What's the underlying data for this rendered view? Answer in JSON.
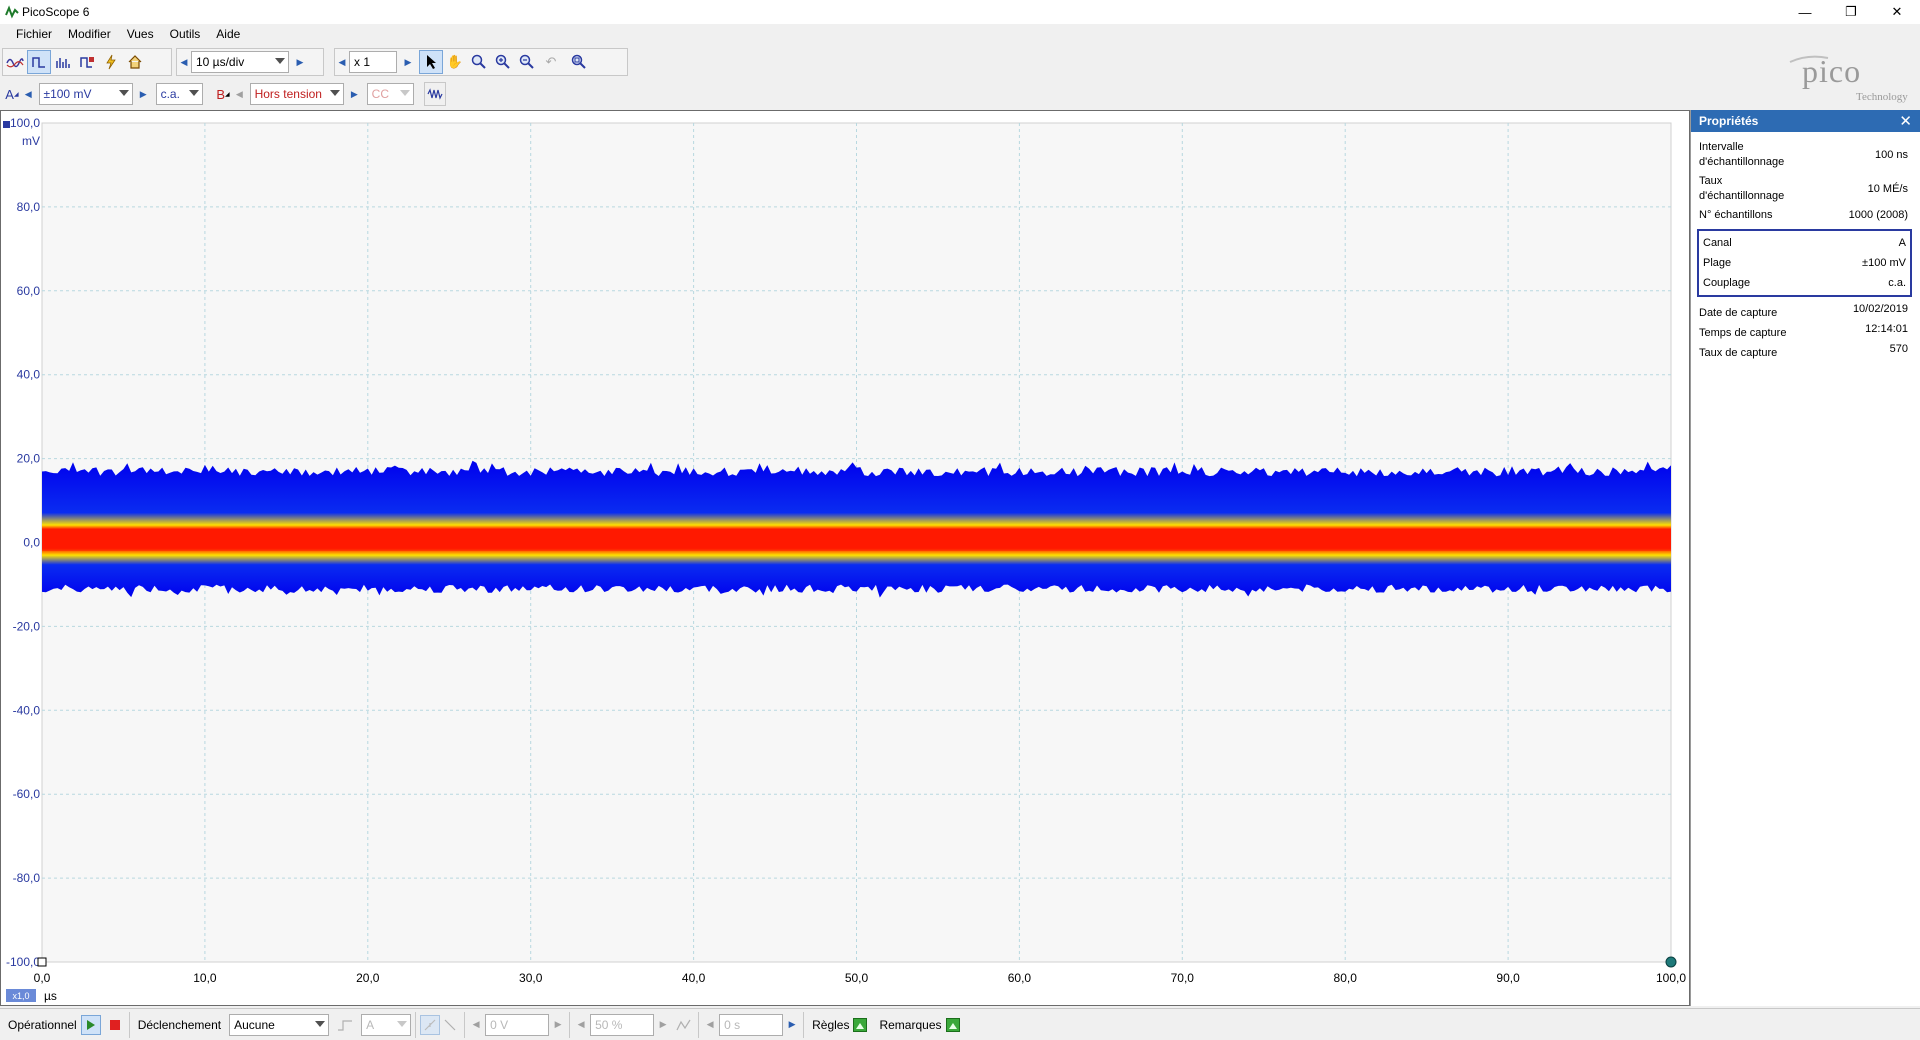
{
  "window": {
    "title": "PicoScope 6",
    "minimize": "—",
    "maximize": "❐",
    "close": "✕"
  },
  "menu": [
    "Fichier",
    "Modifier",
    "Vues",
    "Outils",
    "Aide"
  ],
  "toolbar1": {
    "timebase": "10 µs/div",
    "zoom": "x 1"
  },
  "toolbar2": {
    "channel_a_label": "A",
    "channel_a_range": "±100 mV",
    "channel_a_coupling": "c.a.",
    "channel_b_label": "B",
    "channel_b_range": "Hors tension",
    "channel_b_coupling": "CC"
  },
  "logo": {
    "text": "pico",
    "subtext": "Technology"
  },
  "scope": {
    "y_unit": "mV",
    "x_unit": "µs",
    "x_scale_badge": "x1,0",
    "y_ticks": [
      "100,0",
      "80,0",
      "60,0",
      "40,0",
      "20,0",
      "0,0",
      "-20,0",
      "-40,0",
      "-60,0",
      "-80,0",
      "-100,0"
    ],
    "x_ticks": [
      "0,0",
      "10,0",
      "20,0",
      "30,0",
      "40,0",
      "50,0",
      "60,0",
      "70,0",
      "80,0",
      "90,0",
      "100,0"
    ]
  },
  "chart_data": {
    "type": "line",
    "xlabel": "µs",
    "ylabel": "mV",
    "xlim": [
      0,
      100
    ],
    "ylim": [
      -100,
      100
    ],
    "grid": true,
    "series": [
      {
        "name": "A",
        "envelope_max": 18,
        "envelope_min": -12,
        "dense_core_max": 3,
        "dense_core_min": -2,
        "color": "#0000ee"
      }
    ],
    "colors": {
      "envelope": "#0000ee",
      "mid": "#ffe000",
      "core": "#ff1a00",
      "grid": "#b8d8e0"
    }
  },
  "properties": {
    "title": "Propriétés",
    "close": "✕",
    "top_rows": [
      {
        "label": "Intervalle d'échantillonnage",
        "value": "100 ns"
      },
      {
        "label": "Taux d'échantillonnage",
        "value": "10 MÉ/s"
      },
      {
        "label": "N° échantillons",
        "value": "1000  (2008)"
      }
    ],
    "channel_rows": [
      {
        "label": "Canal",
        "value": "A"
      },
      {
        "label": "Plage",
        "value": "±100 mV"
      },
      {
        "label": "Couplage",
        "value": "c.a."
      }
    ],
    "bottom_rows": [
      {
        "label": "Date de capture",
        "value": "10/02/2019"
      },
      {
        "label": "Temps de capture",
        "value": "12:14:01"
      },
      {
        "label": "Taux de capture",
        "value": "570"
      }
    ]
  },
  "status": {
    "mode": "Opérationnel",
    "trigger_label": "Déclenchement",
    "trigger_value": "Aucune",
    "trigger_channel": "A",
    "threshold": "0 V",
    "pre_trigger": "50 %",
    "delay": "0 s",
    "rulers": "Règles",
    "notes": "Remarques"
  }
}
